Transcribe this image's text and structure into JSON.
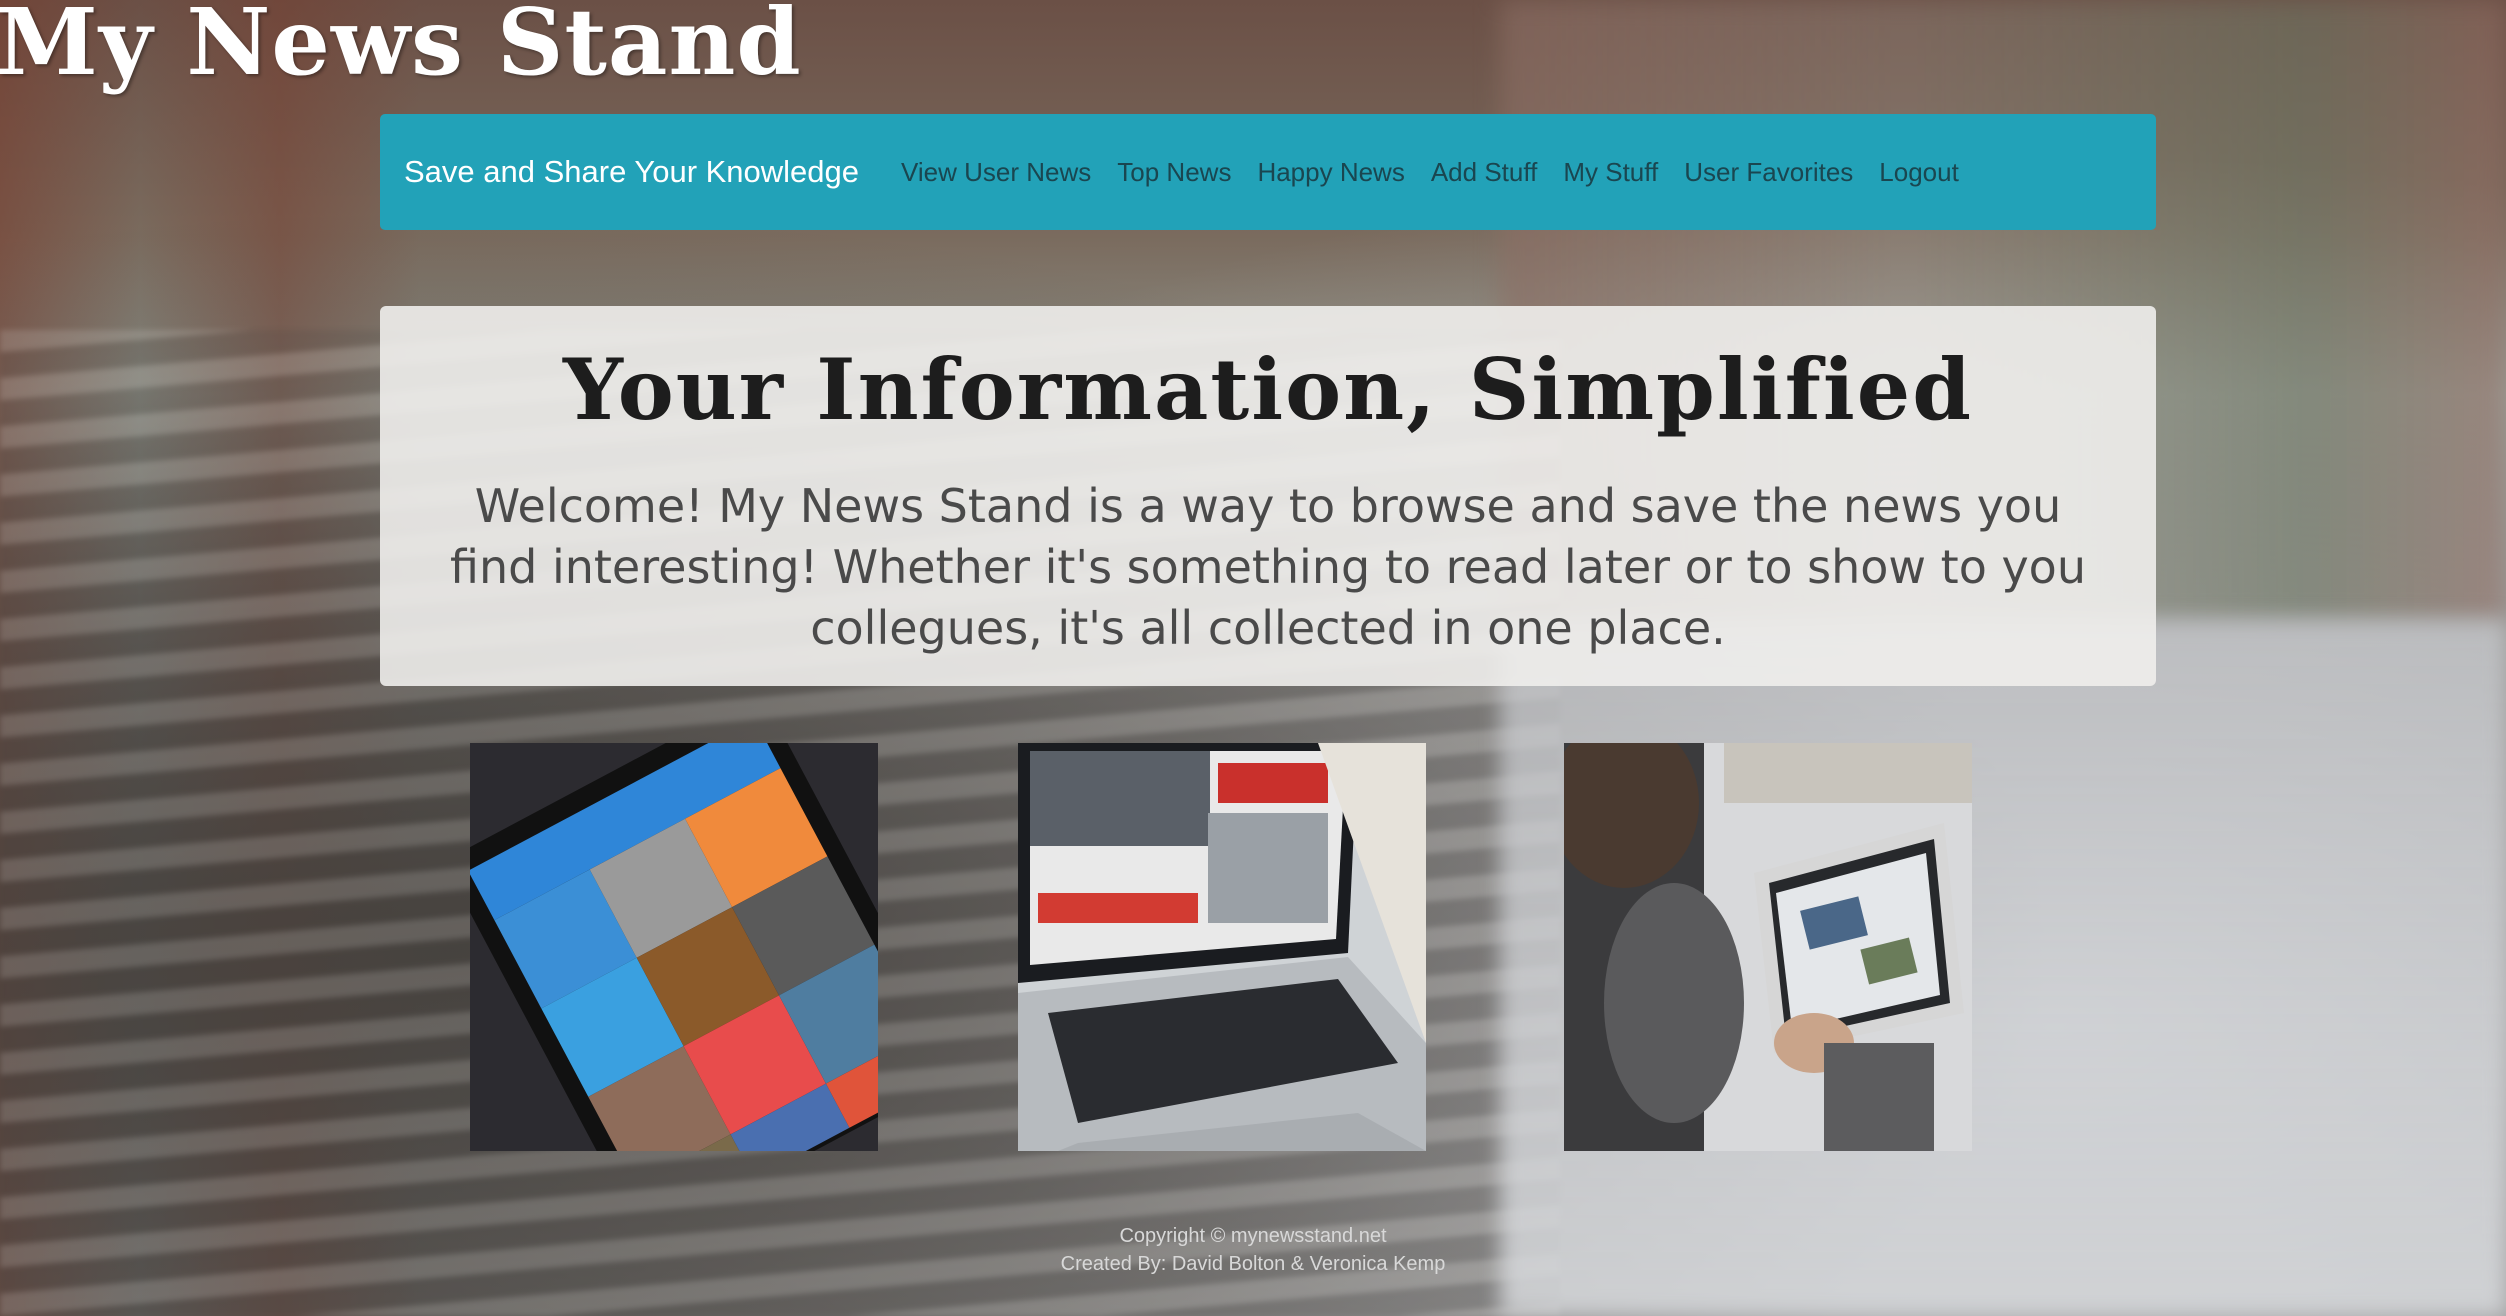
{
  "site": {
    "title": "My News Stand"
  },
  "navbar": {
    "brand": "Save and Share Your Knowledge",
    "links": [
      "View User News",
      "Top News",
      "Happy News",
      "Add Stuff",
      "My Stuff",
      "User Favorites",
      "Logout"
    ],
    "color": "#22a2b8"
  },
  "hero": {
    "title": "Your Information, Simplified",
    "lead": "Welcome! My News Stand is a way to browse and save the news you find interesting! Whether it's something to read later or to show to you collegues, it's all collected in one place."
  },
  "images": [
    "tablet-news-app-photo",
    "laptop-news-site-photo",
    "man-reading-tablet-photo"
  ],
  "footer": {
    "copyright_prefix": "Copyright ©",
    "copyright_link": "mynewsstand.net",
    "created_by": "Created By: David Bolton & Veronica Kemp"
  }
}
